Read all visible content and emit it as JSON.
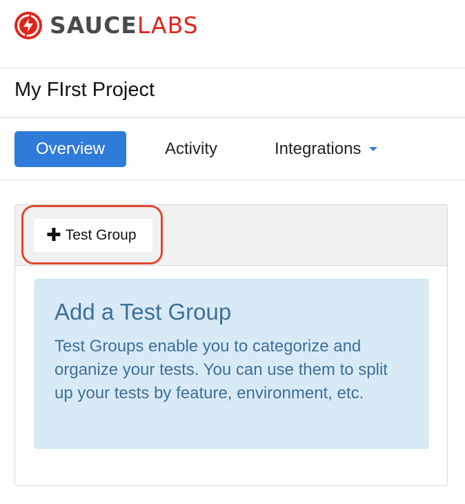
{
  "brand": {
    "word_primary": "SAUCE",
    "word_secondary": "LABS",
    "icon": "sauce-labs-lightning-logo",
    "colors": {
      "primary": "#e2231a",
      "dark": "#4a4a4a"
    }
  },
  "project": {
    "title": "My FIrst Project"
  },
  "tabs": [
    {
      "label": "Overview",
      "active": true
    },
    {
      "label": "Activity",
      "active": false
    },
    {
      "label": "Integrations",
      "active": false,
      "dropdown": true
    }
  ],
  "panel": {
    "add_button": {
      "icon": "plus-icon",
      "label": "Test Group"
    },
    "empty_state": {
      "title": "Add a Test Group",
      "text": "Test Groups enable you to categorize and organize your tests. You can use them to split up your tests by feature, environment, etc."
    }
  },
  "colors": {
    "accent": "#2f7bd9",
    "highlight": "#e0472e",
    "info_bg": "#d9eaf7",
    "info_text": "#3d6f98"
  }
}
